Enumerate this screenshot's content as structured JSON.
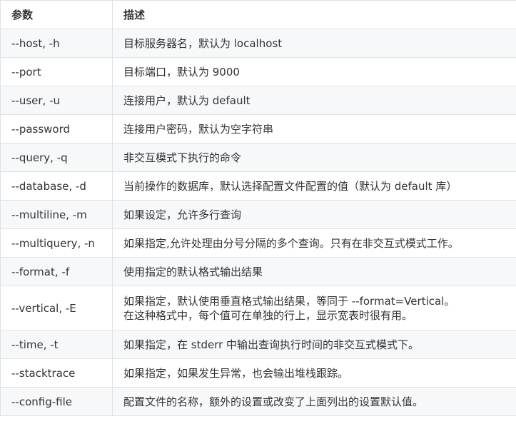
{
  "table": {
    "headers": [
      "参数",
      "描述"
    ],
    "rows": [
      {
        "param": "--host, -h",
        "desc": [
          "目标服务器名，默认为 localhost"
        ]
      },
      {
        "param": "--port",
        "desc": [
          "目标端口，默认为 9000"
        ]
      },
      {
        "param": "--user, -u",
        "desc": [
          "连接用户，默认为 default"
        ]
      },
      {
        "param": "--password",
        "desc": [
          "连接用户密码，默认为空字符串"
        ]
      },
      {
        "param": "--query, -q",
        "desc": [
          "非交互模式下执行的命令"
        ]
      },
      {
        "param": "--database, -d",
        "desc": [
          "当前操作的数据库，默认选择配置文件配置的值（默认为 default 库）"
        ]
      },
      {
        "param": "--multiline, -m",
        "desc": [
          "如果设定，允许多行查询"
        ]
      },
      {
        "param": "--multiquery, -n",
        "desc": [
          "如果指定,允许处理由分号分隔的多个查询。只有在非交互式模式工作。"
        ]
      },
      {
        "param": "--format, -f",
        "desc": [
          "使用指定的默认格式输出结果"
        ]
      },
      {
        "param": "--vertical, -E",
        "desc": [
          "如果指定，默认使用垂直格式输出结果，等同于 --format=Vertical。",
          "在这种格式中，每个值可在单独的行上，显示宽表时很有用。"
        ]
      },
      {
        "param": "--time, -t",
        "desc": [
          "如果指定，在 stderr 中输出查询执行时间的非交互式模式下。"
        ]
      },
      {
        "param": "--stacktrace",
        "desc": [
          "如果指定，如果发生异常，也会输出堆栈跟踪。"
        ]
      },
      {
        "param": "--config-file",
        "desc": [
          "配置文件的名称，额外的设置或改变了上面列出的设置默认值。"
        ]
      }
    ]
  }
}
